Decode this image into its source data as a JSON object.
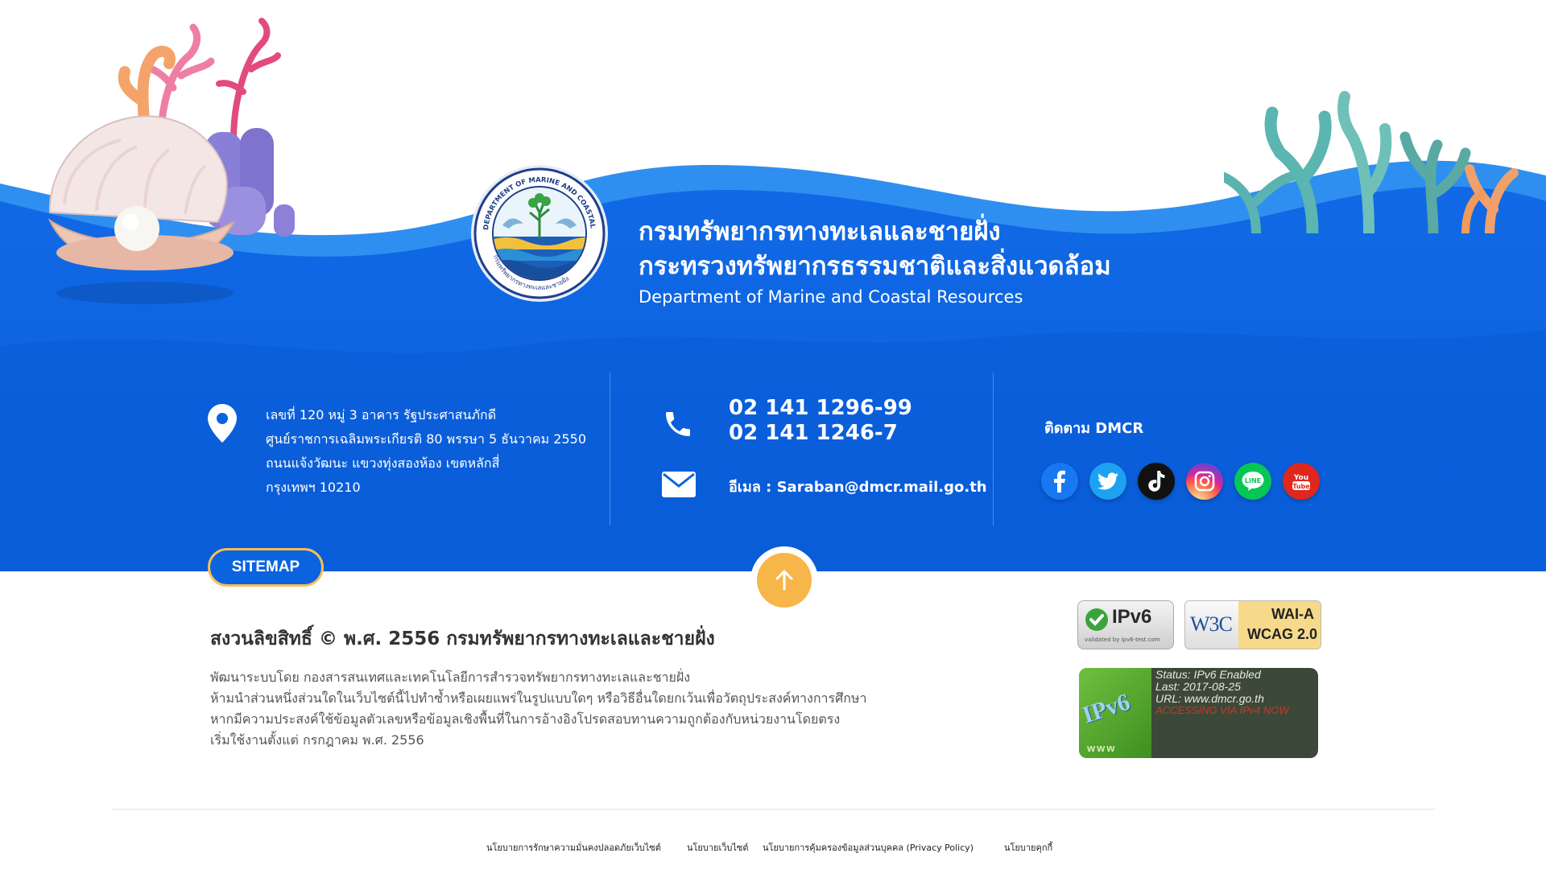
{
  "org": {
    "name_th_1": "กรมทรัพยากรทางทะเลและชายฝั่ง",
    "name_th_2": "กระทรวงทรัพยากรธรรมชาติและสิ่งแวดล้อม",
    "name_en": "Department of Marine and Coastal Resources",
    "logo_ring_text_top": "DEPARTMENT OF MARINE AND COASTAL RESOURCES",
    "logo_ring_text_bottom": "กรมทรัพยากรทางทะเลและชายฝั่ง"
  },
  "address": {
    "lines": [
      "เลขที่ 120 หมู่ 3 อาคาร รัฐประศาสนภักดี",
      "ศูนย์ราชการเฉลิมพระเกียรติ 80 พรรษา 5 ธันวาคม 2550",
      "ถนนแจ้งวัฒนะ แขวงทุ่งสองห้อง เขตหลักสี่",
      "กรุงเทพฯ 10210"
    ]
  },
  "contact": {
    "phone_1": "02 141 1296-99",
    "phone_2": "02 141 1246-7",
    "email": "อีเมล : Saraban@dmcr.mail.go.th"
  },
  "social": {
    "title": "ติดตาม DMCR",
    "items": [
      {
        "name": "facebook-icon",
        "color": "#1877f2"
      },
      {
        "name": "twitter-icon",
        "color": "#1da1f2"
      },
      {
        "name": "tiktok-icon",
        "color": "#111111"
      },
      {
        "name": "instagram-icon",
        "color": "#d6249f"
      },
      {
        "name": "line-icon",
        "color": "#06c755"
      },
      {
        "name": "youtube-icon",
        "color": "#e0261d"
      }
    ]
  },
  "sitemap_label": "SITEMAP",
  "copyright": "สงวนลิขสิทธิ์ © พ.ศ. 2556 กรมทรัพยากรทางทะเลและชายฝั่ง",
  "info_lines": [
    "พัฒนาระบบโดย กองสารสนเทศและเทคโนโลยีการสำรวจทรัพยากรทางทะเลและชายฝั่ง",
    "ห้ามนำส่วนหนึ่งส่วนใดในเว็บไซต์นี้ไปทำซ้ำหรือเผยแพร่ในรูปแบบใดๆ หรือวิธีอื่นใดยกเว้นเพื่อวัตถุประสงค์ทางการศึกษา",
    "หากมีความประสงค์ใช้ข้อมูลตัวเลขหรือข้อมูลเชิงพื้นที่ในการอ้างอิงโปรดสอบทานความถูกต้องกับหน่วยงานโดยตรง",
    "เริ่มใช้งานตั้งแต่ กรกฎาคม พ.ศ. 2556"
  ],
  "badges": {
    "ipv6_title": "IPv6",
    "ipv6_sub": "validated by ipv6-test.com",
    "w3c_logo": "W3C",
    "wai_level": "WAI-A",
    "wcag": "WCAG 2.0",
    "status_lines": [
      "Status: IPv6 Enabled",
      "Last: 2017-08-25",
      "URL: www.dmcr.go.th",
      "ACCESSING VIA IPv4 NOW"
    ],
    "status_logo": "IPv6",
    "status_www": "www"
  },
  "policies": [
    "นโยบายการรักษาความมั่นคงปลอดภัยเว็บไซต์",
    "นโยบายเว็บไซต์",
    "นโยบายการคุ้มครองข้อมูลส่วนบุคคล (Privacy Policy)",
    "นโยบายคุกกี้"
  ],
  "colors": {
    "primary_blue": "#0b63e0",
    "accent_orange": "#f7b64a"
  }
}
